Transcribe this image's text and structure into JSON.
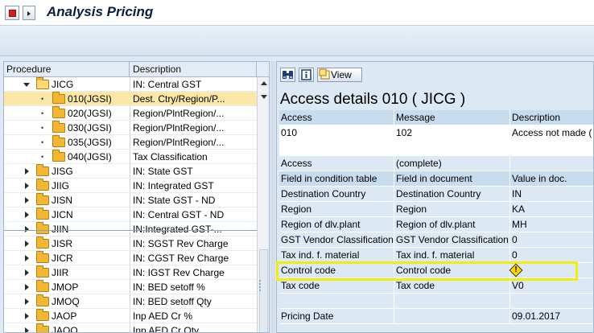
{
  "window": {
    "title": "Analysis Pricing"
  },
  "tree": {
    "columns": [
      "Procedure",
      "Description"
    ],
    "rows": [
      {
        "label": "JICG",
        "desc": "IN: Central GST",
        "level": 1,
        "expander": "expanded",
        "folder": "open"
      },
      {
        "label": "010(JGSI)",
        "desc": "Dest. Ctry/Region/P...",
        "level": 2,
        "expander": "bullet",
        "folder": "closed",
        "selected": true
      },
      {
        "label": "020(JGSI)",
        "desc": "Region/PlntRegion/...",
        "level": 2,
        "expander": "bullet",
        "folder": "closed"
      },
      {
        "label": "030(JGSI)",
        "desc": "Region/PlntRegion/...",
        "level": 2,
        "expander": "bullet",
        "folder": "closed"
      },
      {
        "label": "035(JGSI)",
        "desc": "Region/PlntRegion/...",
        "level": 2,
        "expander": "bullet",
        "folder": "closed"
      },
      {
        "label": "040(JGSI)",
        "desc": "Tax Classification",
        "level": 2,
        "expander": "bullet",
        "folder": "closed"
      },
      {
        "label": "JISG",
        "desc": "IN: State GST",
        "level": 1,
        "expander": "collapsed",
        "folder": "closed"
      },
      {
        "label": "JIIG",
        "desc": "IN: Integrated GST",
        "level": 1,
        "expander": "collapsed",
        "folder": "closed"
      },
      {
        "label": "JISN",
        "desc": "IN: State GST - ND",
        "level": 1,
        "expander": "collapsed",
        "folder": "closed"
      },
      {
        "label": "JICN",
        "desc": "IN: Central GST - ND",
        "level": 1,
        "expander": "collapsed",
        "folder": "closed"
      },
      {
        "label": "JIIN",
        "desc": "IN:Integrated GST-...",
        "level": 1,
        "expander": "collapsed",
        "folder": "closed"
      },
      {
        "label": "JISR",
        "desc": "IN: SGST Rev Charge",
        "level": 1,
        "expander": "collapsed",
        "folder": "closed"
      },
      {
        "label": "JICR",
        "desc": "IN: CGST Rev Charge",
        "level": 1,
        "expander": "collapsed",
        "folder": "closed"
      },
      {
        "label": "JIIR",
        "desc": "IN: IGST Rev Charge",
        "level": 1,
        "expander": "collapsed",
        "folder": "closed"
      },
      {
        "label": "JMOP",
        "desc": "IN: BED setoff %",
        "level": 1,
        "expander": "collapsed",
        "folder": "closed"
      },
      {
        "label": "JMOQ",
        "desc": "IN: BED setoff Qty",
        "level": 1,
        "expander": "collapsed",
        "folder": "closed"
      },
      {
        "label": "JAOP",
        "desc": "Inp AED Cr %",
        "level": 1,
        "expander": "collapsed",
        "folder": "closed"
      },
      {
        "label": "JAOQ",
        "desc": "Inp AED Cr Qty",
        "level": 1,
        "expander": "collapsed",
        "folder": "closed"
      }
    ]
  },
  "detail": {
    "toolbar": {
      "view_label": "View"
    },
    "title": "Access details 010 ( JICG )",
    "columns": [
      "Access",
      "Message",
      "Description"
    ],
    "access_row": [
      "010",
      "102",
      "Access not made ("
    ],
    "sub_header": [
      "Access",
      "(complete)",
      ""
    ],
    "field_header": [
      "Field in condition table",
      "Field in document",
      "Value in doc."
    ],
    "fields": [
      [
        "Destination Country",
        "Destination Country",
        "IN"
      ],
      [
        "Region",
        "Region",
        "KA"
      ],
      [
        "Region of dlv.plant",
        "Region of dlv.plant",
        "MH"
      ],
      [
        "GST Vendor Classification",
        "GST Vendor Classification",
        "0"
      ],
      [
        "Tax ind. f. material",
        "Tax ind. f. material",
        "0"
      ],
      [
        "Control code",
        "Control code",
        ""
      ],
      [
        "Tax code",
        "Tax code",
        "V0"
      ]
    ],
    "pricing_row": [
      "Pricing Date",
      "",
      "09.01.2017"
    ]
  },
  "colors": {
    "highlight": "#f0ec0c",
    "selection": "#fbe7a6",
    "folder": "#f2b632",
    "header": "#c8dcef"
  },
  "icons": [
    "menu-icon",
    "dropdown-icon",
    "binoculars-icon",
    "info-icon",
    "view-icon",
    "warning-icon",
    "folder-icon"
  ]
}
